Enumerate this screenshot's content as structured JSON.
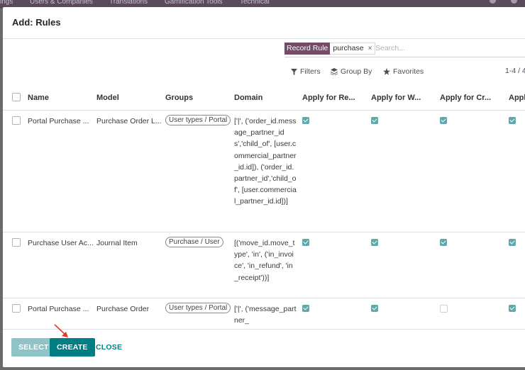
{
  "background_menu": {
    "items": [
      "ings",
      "Users & Companies",
      "Translations",
      "Gamification Tools",
      "Technical"
    ]
  },
  "dialog": {
    "title": "Add: Rules"
  },
  "search": {
    "facet_label": "Record Rule",
    "facet_value": "purchase",
    "facet_close": "×",
    "placeholder": "Search...",
    "value": ""
  },
  "controls": {
    "filters": "Filters",
    "group_by": "Group By",
    "favorites": "Favorites",
    "pager": "1-4 / 4"
  },
  "table": {
    "columns": [
      "Name",
      "Model",
      "Groups",
      "Domain",
      "Apply for Re...",
      "Apply for W...",
      "Apply for Cr...",
      "Appl"
    ],
    "rows": [
      {
        "name": "Portal Purchase ...",
        "model": "Purchase Order L...",
        "group": "User types / Portal",
        "domain": "['|', ('order_id.message_partner_ids','child_of', [user.commercial_partner_id.id]), ('order_id.partner_id','child_of', [user.commercial_partner_id.id])]",
        "apply": [
          true,
          true,
          true,
          true
        ]
      },
      {
        "name": "Purchase User Ac...",
        "model": "Journal Item",
        "group": "Purchase / User",
        "domain": "[('move_id.move_type', 'in', ('in_invoice', 'in_refund', 'in_receipt'))]",
        "apply": [
          true,
          true,
          true,
          true
        ]
      },
      {
        "name": "Portal Purchase ...",
        "model": "Purchase Order",
        "group": "User types / Portal",
        "domain": "['|', ('message_partner_",
        "apply": [
          true,
          true,
          false,
          true
        ]
      }
    ]
  },
  "footer": {
    "select": "SELECT",
    "create": "CREATE",
    "close": "CLOSE"
  },
  "colors": {
    "primary": "#017e84",
    "facet": "#714b67",
    "checkbox": "#5fa8ab",
    "annotation_arrow": "#e03a2f"
  }
}
